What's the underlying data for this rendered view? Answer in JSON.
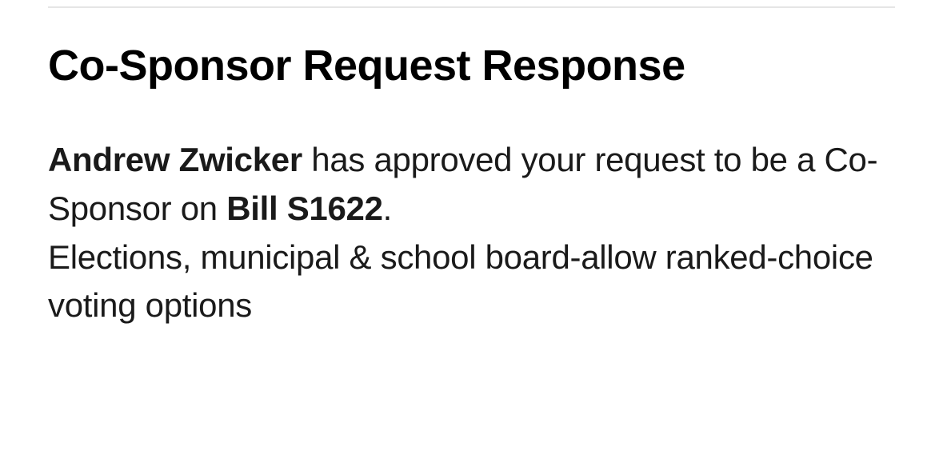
{
  "heading": "Co-Sponsor Request Response",
  "message": {
    "approver_name": "Andrew Zwicker",
    "text_part1": " has approved your request to be a Co-Sponsor on ",
    "bill_label": "Bill S1622",
    "text_part2": ".",
    "description": "Elections, municipal & school board-allow ranked-choice voting options"
  }
}
